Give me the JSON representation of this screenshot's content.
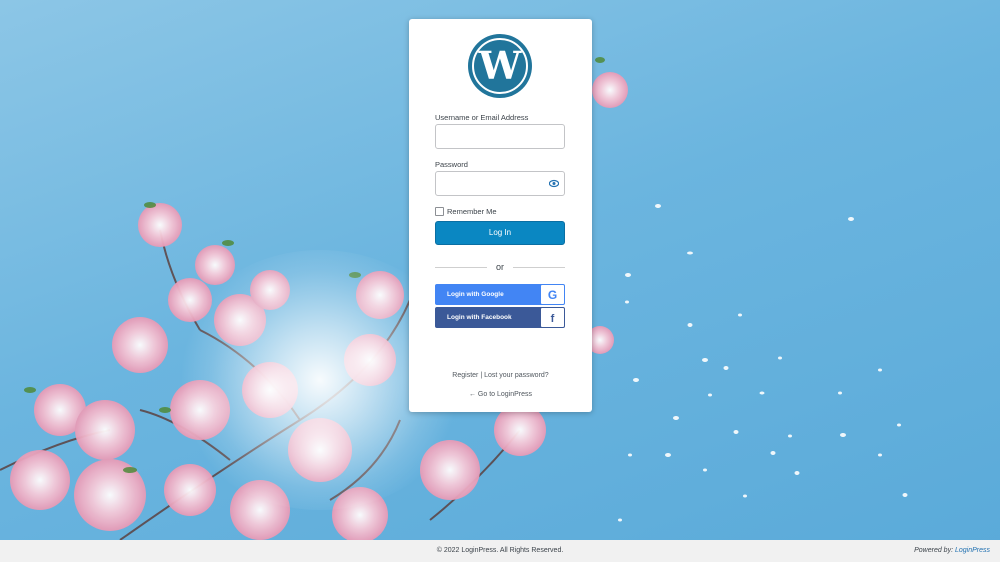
{
  "logo": {
    "icon": "wordpress-logo-icon",
    "color": "#21759b"
  },
  "form": {
    "username_label": "Username or Email Address",
    "username_value": "",
    "password_label": "Password",
    "password_value": "",
    "remember_label": "Remember Me",
    "login_button": "Log In",
    "accent_color": "#0a87c2"
  },
  "divider": {
    "text": "or"
  },
  "social": {
    "google_label": "Login with Google",
    "facebook_label": "Login with Facebook",
    "google_color": "#4285f4",
    "facebook_color": "#3b5998",
    "google_icon": "google-g-icon",
    "facebook_icon": "facebook-f-icon"
  },
  "links": {
    "register": "Register",
    "separator": " | ",
    "lost_password": "Lost your password?",
    "back_to_site": "← Go to LoginPress"
  },
  "footer": {
    "copyright": "© 2022 LoginPress. All Rights Reserved.",
    "powered_prefix": "Powered by: ",
    "powered_link": "LoginPress"
  }
}
